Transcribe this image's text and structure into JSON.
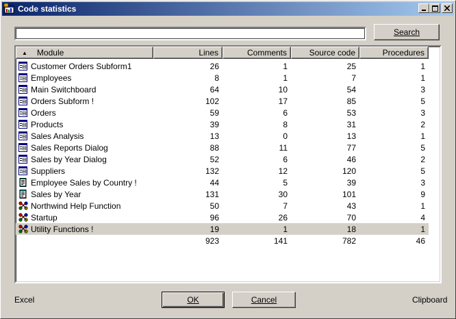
{
  "window": {
    "title": "Code statistics"
  },
  "search": {
    "value": "",
    "button_label": "Search"
  },
  "table": {
    "columns": [
      "Module",
      "Lines",
      "Comments",
      "Source code",
      "Procedures"
    ],
    "rows": [
      {
        "icon": "form-icon",
        "name": "Customer Orders Subform1",
        "lines": "26",
        "comments": "1",
        "source": "25",
        "procedures": "1"
      },
      {
        "icon": "form-icon",
        "name": "Employees",
        "lines": "8",
        "comments": "1",
        "source": "7",
        "procedures": "1"
      },
      {
        "icon": "form-icon",
        "name": "Main Switchboard",
        "lines": "64",
        "comments": "10",
        "source": "54",
        "procedures": "3"
      },
      {
        "icon": "form-icon",
        "name": "Orders Subform !",
        "lines": "102",
        "comments": "17",
        "source": "85",
        "procedures": "5"
      },
      {
        "icon": "form-icon",
        "name": "Orders",
        "lines": "59",
        "comments": "6",
        "source": "53",
        "procedures": "3"
      },
      {
        "icon": "form-icon",
        "name": "Products",
        "lines": "39",
        "comments": "8",
        "source": "31",
        "procedures": "2"
      },
      {
        "icon": "form-icon",
        "name": "Sales Analysis",
        "lines": "13",
        "comments": "0",
        "source": "13",
        "procedures": "1"
      },
      {
        "icon": "form-icon",
        "name": "Sales Reports Dialog",
        "lines": "88",
        "comments": "11",
        "source": "77",
        "procedures": "5"
      },
      {
        "icon": "form-icon",
        "name": "Sales by Year Dialog",
        "lines": "52",
        "comments": "6",
        "source": "46",
        "procedures": "2"
      },
      {
        "icon": "form-icon",
        "name": "Suppliers",
        "lines": "132",
        "comments": "12",
        "source": "120",
        "procedures": "5"
      },
      {
        "icon": "report-icon",
        "name": "Employee Sales by Country !",
        "lines": "44",
        "comments": "5",
        "source": "39",
        "procedures": "3"
      },
      {
        "icon": "report-icon",
        "name": "Sales by Year",
        "lines": "131",
        "comments": "30",
        "source": "101",
        "procedures": "9"
      },
      {
        "icon": "module-icon",
        "name": "Northwind Help Function",
        "lines": "50",
        "comments": "7",
        "source": "43",
        "procedures": "1"
      },
      {
        "icon": "module-icon",
        "name": "Startup",
        "lines": "96",
        "comments": "26",
        "source": "70",
        "procedures": "4"
      },
      {
        "icon": "module-icon",
        "name": "Utility Functions !",
        "lines": "19",
        "comments": "1",
        "source": "18",
        "procedures": "1"
      }
    ],
    "selected_row": 14,
    "totals": {
      "lines": "923",
      "comments": "141",
      "source": "782",
      "procedures": "46"
    }
  },
  "footer": {
    "excel_label": "Excel",
    "ok_label": "OK",
    "cancel_label": "Cancel",
    "clipboard_label": "Clipboard"
  },
  "colors": {
    "titlebar_start": "#0a246a",
    "titlebar_end": "#a6caf0",
    "face": "#d4d0c8"
  }
}
